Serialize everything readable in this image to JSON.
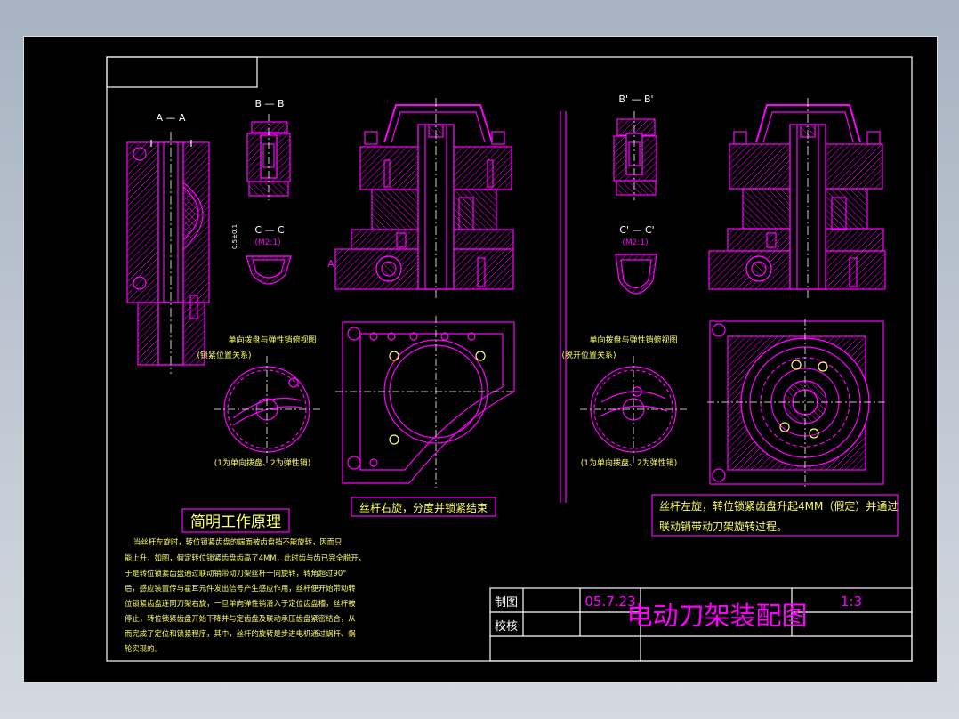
{
  "views": {
    "aa": "A — A",
    "bb": "B — B",
    "cc": "C — C",
    "cc_scale": "(M2:1)",
    "b2": "B' — B'",
    "c2": "C' — C'",
    "c2_scale": "(M2:1)",
    "cut_a": "A",
    "dim": "0.5±0.1"
  },
  "notes": {
    "cam_left_title": "单向拨盘与弹性销俯视图",
    "cam_left_sub": "(锁紧位置关系)",
    "cam_left_note": "(1为单向拨盘、2为弹性销)",
    "cam_right_title": "单向拨盘与弹性销俯视图",
    "cam_right_sub": "(脱开位置关系)",
    "cam_right_note": "(1为单向拨盘、2为弹性销)",
    "box_left": "丝杆右旋，分度并锁紧结束",
    "box_right_1": "丝杆左旋，转位锁紧齿盘升起4MM（假定）并通过",
    "box_right_2": "联动销带动刀架旋转过程。"
  },
  "principle": {
    "title": "简明工作原理",
    "lines": [
      "当丝杆左旋时，转位锁紧齿盘的端面被齿盘挡不能旋转，因而只",
      "能上升，如图，假定转位锁紧齿盘齿高了4MM，此时齿与齿已完全脱开，",
      "于是转位锁紧齿盘通过联动销带动刀架丝杆一同旋转，转角超过90°",
      "后，感应装置传与霍耳元件发出信号产生感应作用，丝杆便开始带动转",
      "位锁紧齿盘连同刀架右旋，一旦单向弹性销滑入于定位齿盘槽，丝杆被",
      "停止，转位锁紧齿盘开始下降并与定齿盘及联动承压齿盘紧密结合，从",
      "而完成了定位和锁紧程序，其中，丝杆的旋转是步进电机通过蜗杆、蜗",
      "轮实现的。"
    ]
  },
  "title_block": {
    "drawn_label": "制图",
    "check_label": "校核",
    "date": "05.7.23",
    "title": "电动刀架装配图",
    "scale": "1:3"
  }
}
